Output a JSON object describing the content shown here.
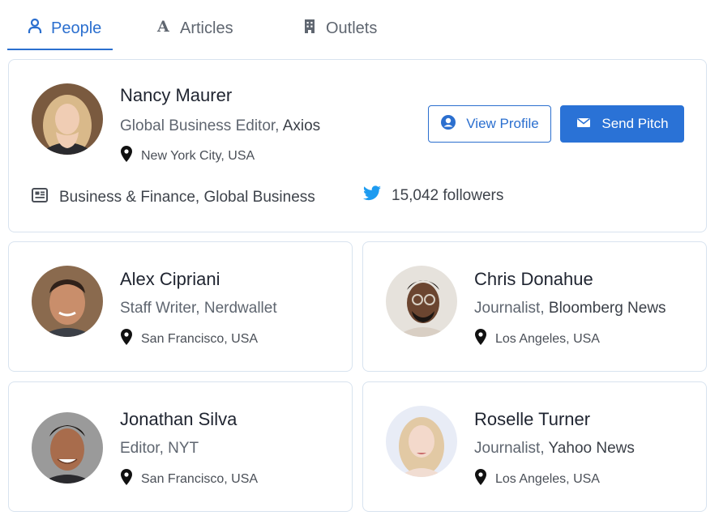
{
  "tabs": [
    {
      "label": "People",
      "icon": "person-icon",
      "active": true
    },
    {
      "label": "Articles",
      "icon": "article-letter-icon",
      "active": false
    },
    {
      "label": "Outlets",
      "icon": "building-icon",
      "active": false
    }
  ],
  "featured": {
    "name": "Nancy Maurer",
    "role_title": "Global Business Editor,",
    "outlet": "Axios",
    "location": "New York City, USA",
    "topics": "Business & Finance, Global Business",
    "followers": "15,042 followers",
    "view_profile_label": "View Profile",
    "send_pitch_label": "Send Pitch"
  },
  "people": [
    {
      "name": "Alex Cipriani",
      "role_title": "Staff Writer,",
      "outlet": "Nerdwallet",
      "location": "San Francisco, USA"
    },
    {
      "name": "Chris Donahue",
      "role_title": "Journalist,",
      "outlet": "Bloomberg News",
      "location": "Los Angeles, USA"
    },
    {
      "name": "Jonathan Silva",
      "role_title": "Editor,",
      "outlet": "NYT",
      "location": "San Francisco, USA"
    },
    {
      "name": "Roselle Turner",
      "role_title": "Journalist,",
      "outlet": "Yahoo News",
      "location": "Los Angeles, USA"
    }
  ],
  "colors": {
    "accent": "#2b6fcf",
    "twitter": "#1d9bf0",
    "card_border": "#d8e3ef"
  }
}
